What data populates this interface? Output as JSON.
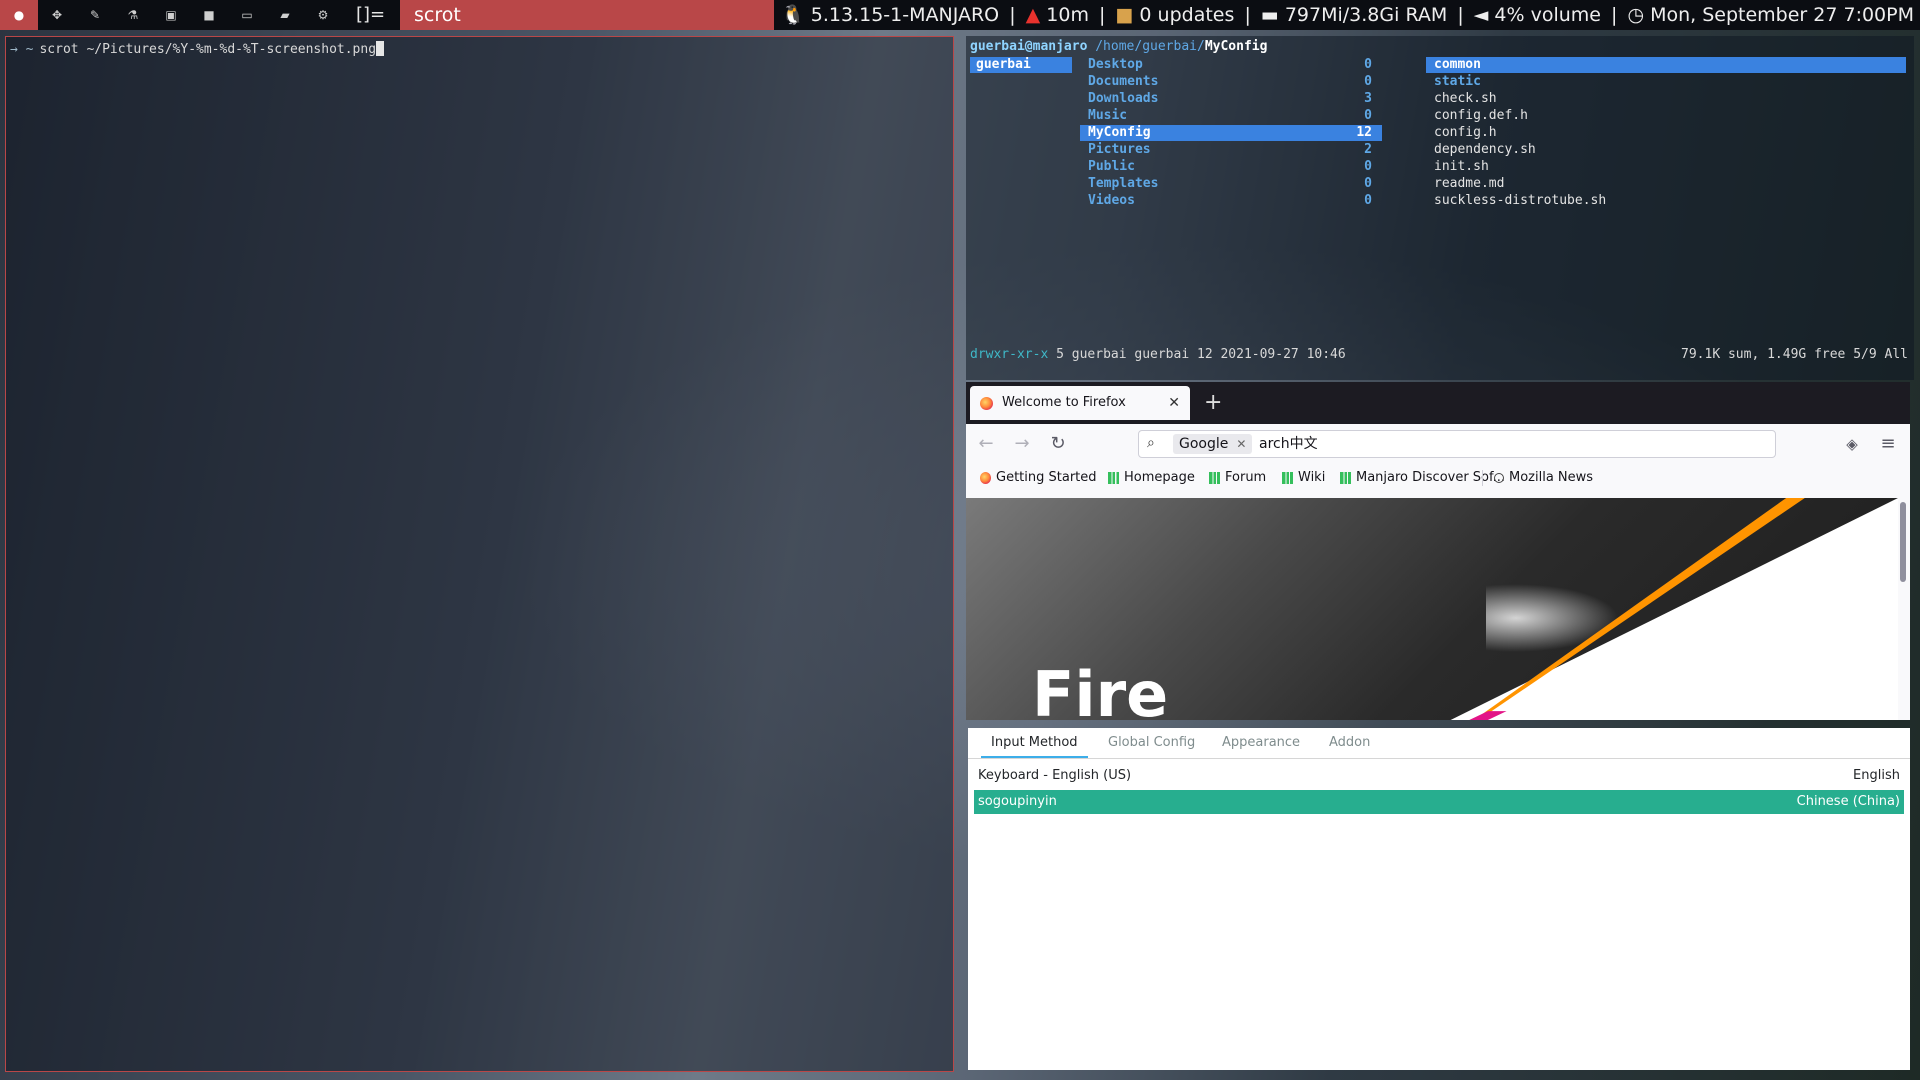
{
  "topbar": {
    "tag_icons": [
      "manjaro-icon",
      "game-icon",
      "pen-icon",
      "flask-icon",
      "image-icon",
      "video-icon",
      "laptop-icon",
      "folder-icon",
      "settings-icon"
    ],
    "layout_symbol": "[]=",
    "window_title": "scrot",
    "status": {
      "kernel": "5.13.15-1-MANJARO",
      "uptime": "10m",
      "updates": "0 updates",
      "ram": "797Mi/3.8Gi RAM",
      "volume": "4% volume",
      "datetime": "Mon, September 27 7:00PM",
      "separator": "|"
    },
    "colors": {
      "accent": "#b94748",
      "bar_bg": "#0b0d12"
    }
  },
  "terminal": {
    "prompt": "→ ~",
    "command": "scrot ~/Pictures/%Y-%m-%d-%T-screenshot.png"
  },
  "ranger": {
    "user_host": "guerbai@manjaro",
    "path": "/home/guerbai/",
    "current": "MyConfig",
    "parent_selected": "guerbai",
    "dirs": [
      {
        "name": "Desktop",
        "count": "0"
      },
      {
        "name": "Documents",
        "count": "0"
      },
      {
        "name": "Downloads",
        "count": "3"
      },
      {
        "name": "Music",
        "count": "0"
      },
      {
        "name": "MyConfig",
        "count": "12"
      },
      {
        "name": "Pictures",
        "count": "2"
      },
      {
        "name": "Public",
        "count": "0"
      },
      {
        "name": "Templates",
        "count": "0"
      },
      {
        "name": "Videos",
        "count": "0"
      }
    ],
    "files": [
      {
        "name": "common",
        "type": "dir",
        "selected": true
      },
      {
        "name": "static",
        "type": "dir"
      },
      {
        "name": "check.sh",
        "type": "file"
      },
      {
        "name": "config.def.h",
        "type": "file"
      },
      {
        "name": "config.h",
        "type": "file"
      },
      {
        "name": "dependency.sh",
        "type": "file"
      },
      {
        "name": "init.sh",
        "type": "file"
      },
      {
        "name": "readme.md",
        "type": "file"
      },
      {
        "name": "suckless-distrotube.sh",
        "type": "file"
      }
    ],
    "footer": {
      "perm": "drwxr-xr-x",
      "info": "5 guerbai guerbai 12 2021-09-27 10:46",
      "right": "79.1K sum, 1.49G free  5/9  All"
    }
  },
  "firefox": {
    "tab_title": "Welcome to Firefox",
    "new_tab": "+",
    "search_engine": "Google",
    "url_text": "arch中文",
    "bookmarks": [
      "Getting Started",
      "Homepage",
      "Forum",
      "Wiki",
      "Manjaro Discover Sof...",
      "Mozilla News"
    ],
    "hero_text": "Fire"
  },
  "fcitx": {
    "tabs": [
      "Input Method",
      "Global Config",
      "Appearance",
      "Addon"
    ],
    "rows": [
      {
        "name": "Keyboard - English (US)",
        "lang": "English"
      },
      {
        "name": "sogoupinyin",
        "lang": "Chinese (China)",
        "selected": true
      }
    ]
  }
}
